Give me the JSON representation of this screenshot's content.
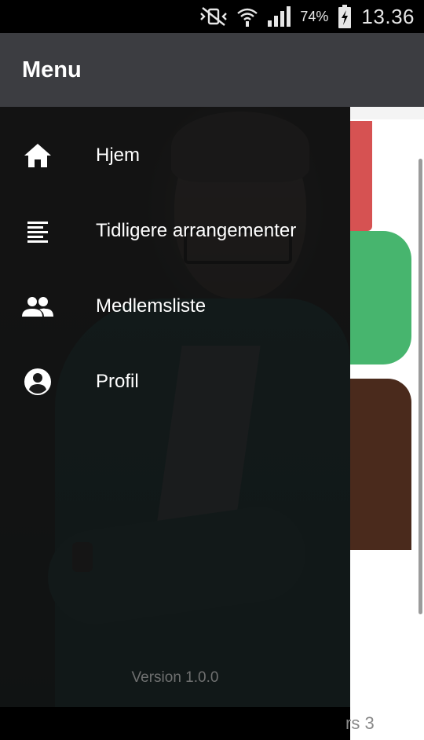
{
  "status_bar": {
    "battery_percent": "74%",
    "time": "13.36",
    "icons": [
      "vibrate-mute-icon",
      "wifi-icon",
      "signal-icon",
      "battery-charging-icon"
    ]
  },
  "drawer": {
    "title": "Menu",
    "items": [
      {
        "label": "Hjem",
        "icon": "home-icon"
      },
      {
        "label": "Tidligere arrangementer",
        "icon": "list-icon"
      },
      {
        "label": "Medlemsliste",
        "icon": "people-icon"
      },
      {
        "label": "Profil",
        "icon": "account-circle-icon"
      }
    ],
    "version": "Version 1.0.0"
  },
  "background": {
    "partial_text": "rs 3"
  }
}
